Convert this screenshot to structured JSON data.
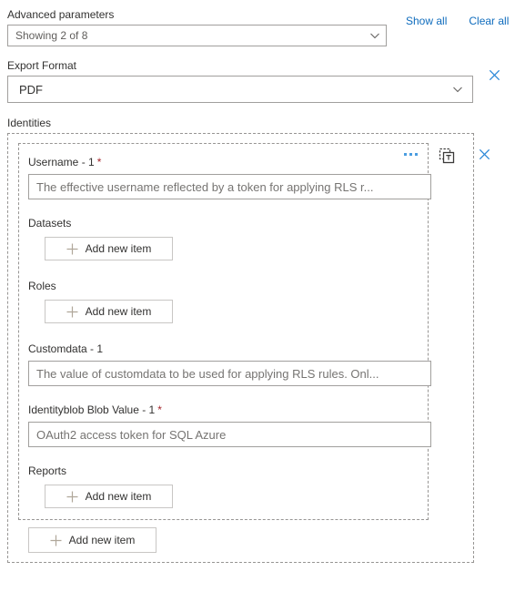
{
  "advanced_parameters": {
    "label": "Advanced parameters",
    "dropdown_value": "Showing 2 of 8",
    "show_all_link": "Show all",
    "clear_all_link": "Clear all"
  },
  "export_format": {
    "label": "Export Format",
    "value": "PDF"
  },
  "identities": {
    "label": "Identities",
    "card": {
      "username": {
        "label": "Username - 1",
        "required": "*",
        "placeholder": "The effective username reflected by a token for applying RLS r..."
      },
      "datasets": {
        "label": "Datasets",
        "add_label": "Add new item"
      },
      "roles": {
        "label": "Roles",
        "add_label": "Add new item"
      },
      "customdata": {
        "label": "Customdata - 1",
        "placeholder": "The value of customdata to be used for applying RLS rules. Onl..."
      },
      "identityblob": {
        "label": "Identityblob Blob Value - 1",
        "required": "*",
        "placeholder": "OAuth2 access token for SQL Azure"
      },
      "reports": {
        "label": "Reports",
        "add_label": "Add new item"
      }
    },
    "add_item_label": "Add new item"
  },
  "colors": {
    "link_blue": "#0f6cbd",
    "icon_blue": "#4a9de0",
    "required_red": "#a4262c",
    "border_gray": "#a19f9d",
    "dashed_gray": "#979593",
    "plus_tan": "#b0a79a"
  },
  "icons": {
    "chevron_down": "chevron-down-icon",
    "close": "close-icon",
    "ellipsis": "ellipsis-icon",
    "text_mode": "text-mode-icon",
    "plus": "plus-icon"
  }
}
